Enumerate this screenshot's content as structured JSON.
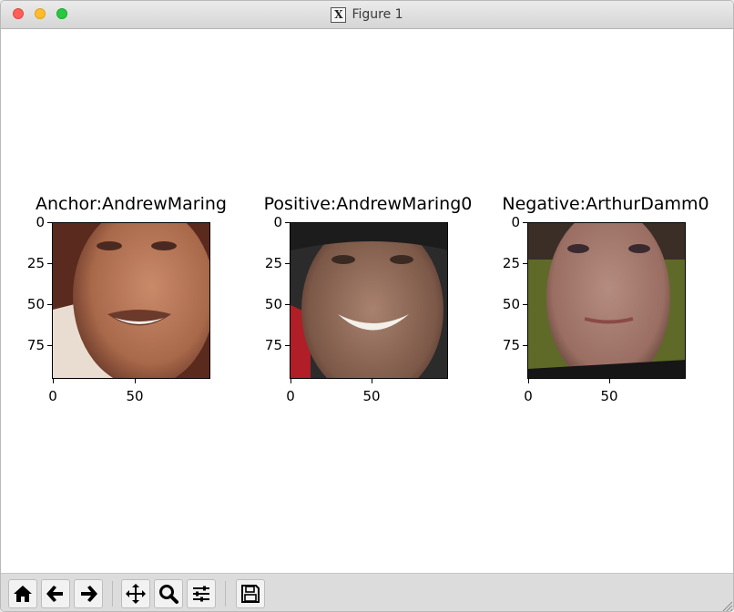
{
  "window": {
    "title": "Figure 1"
  },
  "panels": [
    {
      "title": "Anchor:AndrewMaring",
      "yticks": [
        "0",
        "25",
        "50",
        "75"
      ],
      "xticks": [
        "0",
        "50"
      ]
    },
    {
      "title": "Positive:AndrewMaring0",
      "yticks": [
        "0",
        "25",
        "50",
        "75"
      ],
      "xticks": [
        "0",
        "50"
      ]
    },
    {
      "title": "Negative:ArthurDamm0",
      "yticks": [
        "0",
        "25",
        "50",
        "75"
      ],
      "xticks": [
        "0",
        "50"
      ]
    }
  ],
  "toolbar": {
    "buttons": [
      "home-icon",
      "back-arrow-icon",
      "forward-arrow-icon",
      "pan-icon",
      "zoom-icon",
      "configure-subplots-icon",
      "save-icon"
    ]
  }
}
